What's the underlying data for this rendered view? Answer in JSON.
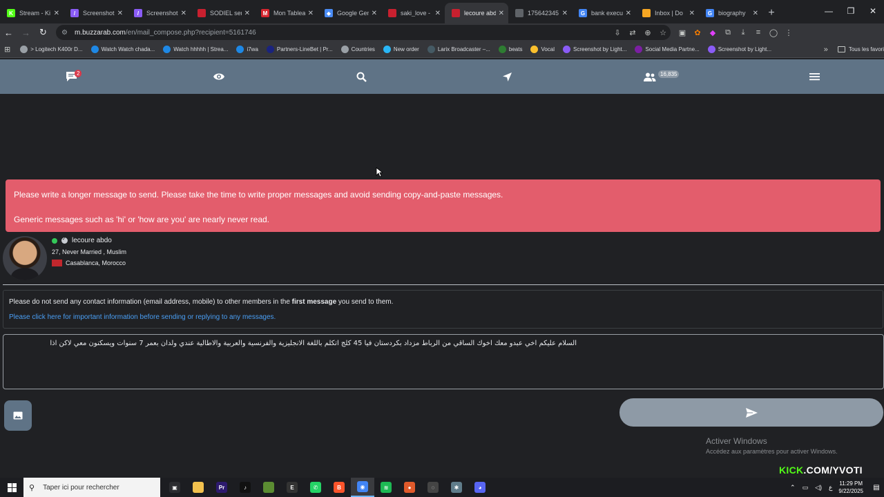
{
  "browser": {
    "tabs": [
      {
        "label": "Stream - Ki",
        "color": "#53fc18",
        "glyph": "K",
        "active": false
      },
      {
        "label": "Screenshot",
        "color": "#8a5cf6",
        "glyph": "/",
        "active": false
      },
      {
        "label": "Screenshot",
        "color": "#8a5cf6",
        "glyph": "/",
        "active": false
      },
      {
        "label": "SODIEL sen",
        "color": "#c8202f",
        "glyph": "",
        "active": false
      },
      {
        "label": "Mon Tablea",
        "color": "#d6262f",
        "glyph": "M",
        "active": false
      },
      {
        "label": "Google Gen",
        "color": "#4a8cf5",
        "glyph": "◆",
        "active": false
      },
      {
        "label": "saki_love -",
        "color": "#c8202f",
        "glyph": "",
        "active": false
      },
      {
        "label": "lecoure abd",
        "color": "#c8202f",
        "glyph": "",
        "active": true
      },
      {
        "label": "175642345",
        "color": "#5f6368",
        "glyph": "",
        "active": false
      },
      {
        "label": "bank execu",
        "color": "#4285f4",
        "glyph": "G",
        "active": false
      },
      {
        "label": "Inbox | Do",
        "color": "#f5a623",
        "glyph": "",
        "active": false
      },
      {
        "label": "biography",
        "color": "#4285f4",
        "glyph": "G",
        "active": false
      }
    ],
    "url_host": "m.buzzarab.com",
    "url_path": "/en/mail_compose.php?recipient=5161746",
    "bookmarks": [
      {
        "label": "> Logitech K400r D...",
        "color": "#9aa0a6"
      },
      {
        "label": "Watch Watch chada...",
        "color": "#1e88e5"
      },
      {
        "label": "Watch hhhhh | Strea...",
        "color": "#1e88e5"
      },
      {
        "label": "i7wa",
        "color": "#1e88e5"
      },
      {
        "label": "Partners-LineBet | Pr...",
        "color": "#1a237e"
      },
      {
        "label": "Countries",
        "color": "#9aa0a6"
      },
      {
        "label": "New order",
        "color": "#29b6f6"
      },
      {
        "label": "Larix Broadcaster –...",
        "color": "#455a64"
      },
      {
        "label": "beats",
        "color": "#2e7d32"
      },
      {
        "label": "Vocal",
        "color": "#fbc02d"
      },
      {
        "label": "Screenshot by Light...",
        "color": "#8a5cf6"
      },
      {
        "label": "Social Media Partne...",
        "color": "#7b1fa2"
      },
      {
        "label": "Screenshot by Light...",
        "color": "#8a5cf6"
      }
    ],
    "other_bookmarks": "Tous les favori"
  },
  "site_nav": {
    "messages_badge": "2",
    "members_badge": "16,835"
  },
  "alert": {
    "line1": "Please write a longer message to send. Please take the time to write proper messages and avoid sending copy-and-paste messages.",
    "line2": "Generic messages such as 'hi' or 'how are you' are nearly never read."
  },
  "profile": {
    "name": "lecoure abdo",
    "details": "27, Never Married , Muslim",
    "location": "Casablanca, Morocco"
  },
  "notice": {
    "text_before": "Please do not send any contact information (email address, mobile) to other members in the ",
    "text_bold": "first message",
    "text_after": " you send to them.",
    "link": "Please click here for important information before sending or replying to any messages."
  },
  "compose": {
    "message": "السلام عليكم اخي عبدو معك اخوك الساقي من الرباط مزداد بكردستان فيا 45 كلج اتكلم باللغة الانجليزية والفرنسية والعربية والاطالية عندي ولدان بعمر 7 سنوات ويسكنون معي لاكن اذا"
  },
  "overlay": {
    "activate_title": "Activer Windows",
    "activate_sub": "Accédez aux paramètres pour activer Windows.",
    "kick_k": "KICK",
    "kick_rest": ".COM/YVOTI"
  },
  "taskbar": {
    "search_placeholder": "Taper ici pour rechercher",
    "apps": [
      {
        "name": "task-view",
        "color": "#2b2c30",
        "glyph": "▣"
      },
      {
        "name": "file-explorer",
        "color": "#f2c14e",
        "glyph": ""
      },
      {
        "name": "premiere",
        "color": "#2d1a6e",
        "glyph": "Pr"
      },
      {
        "name": "tiktok",
        "color": "#111111",
        "glyph": "♪"
      },
      {
        "name": "minecraft",
        "color": "#5b8c32",
        "glyph": ""
      },
      {
        "name": "epic-games",
        "color": "#333333",
        "glyph": "E"
      },
      {
        "name": "whatsapp",
        "color": "#25d366",
        "glyph": "✆"
      },
      {
        "name": "brave",
        "color": "#fb542b",
        "glyph": "B"
      },
      {
        "name": "chrome",
        "color": "#4285f4",
        "glyph": "◉",
        "active": true
      },
      {
        "name": "spotify",
        "color": "#1db954",
        "glyph": "≋"
      },
      {
        "name": "microphone",
        "color": "#e05a2b",
        "glyph": "●"
      },
      {
        "name": "obs",
        "color": "#444444",
        "glyph": "◌"
      },
      {
        "name": "app-blue",
        "color": "#607d8b",
        "glyph": "✱"
      },
      {
        "name": "discord",
        "color": "#5865f2",
        "glyph": "◕"
      }
    ],
    "lang": "ع",
    "time": "11:29 PM",
    "date": "9/22/2025"
  }
}
